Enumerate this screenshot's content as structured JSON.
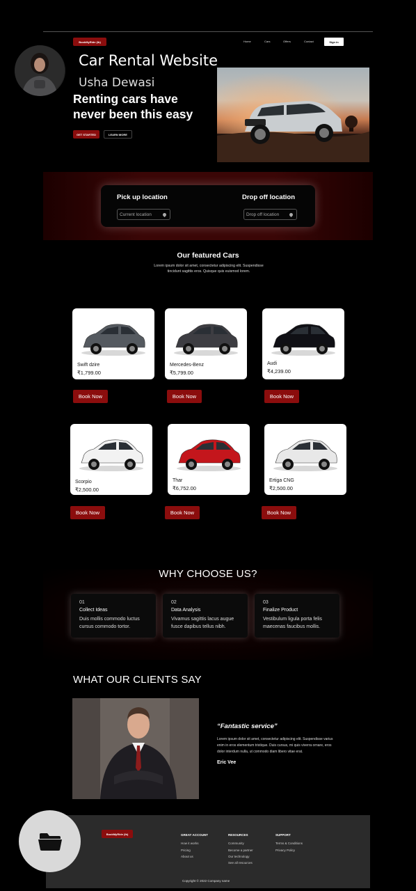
{
  "brand": "BookMyRide (ib)",
  "nav": {
    "links": [
      "Home",
      "Cars",
      "Offers",
      "Contact"
    ],
    "signin": "Sign in"
  },
  "overlay": {
    "title": "Car Rental Website",
    "name": "Usha Dewasi"
  },
  "hero": {
    "title": "Renting cars have never been this easy",
    "get_started": "GET STARTED",
    "learn_more": "LEARN MORE"
  },
  "location": {
    "pickup_label": "Pick up location",
    "pickup_placeholder": "Current location",
    "dropoff_label": "Drop off location",
    "dropoff_placeholder": "Drop off location"
  },
  "featured": {
    "title": "Our featured Cars",
    "description": "Lorem ipsum dolor sit amet, consectetur adipiscing elit. Suspendisse tincidunt sagittis eros. Quisque quis euismod lorem."
  },
  "cars": [
    {
      "name": "Swift dzire",
      "price": "₹1,799.00",
      "color": "#555a60"
    },
    {
      "name": "Mercedes-Benz",
      "price": "₹5,799.00",
      "color": "#3d3d42"
    },
    {
      "name": "Audi",
      "price": "₹4,239.00",
      "color": "#101015"
    },
    {
      "name": "Scorpio",
      "price": "₹2,500.00",
      "color": "#f2f2f2"
    },
    {
      "name": "Thar",
      "price": "₹6,752.00",
      "color": "#c4161c"
    },
    {
      "name": "Ertiga CNG",
      "price": "₹2,500.00",
      "color": "#e8e8e8"
    }
  ],
  "book_now": "Book Now",
  "why": {
    "title": "WHY CHOOSE US?",
    "items": [
      {
        "num": "01",
        "head": "Collect Ideas",
        "text": "Duis mollis commodo luctus cursus commodo tortor."
      },
      {
        "num": "02",
        "head": "Data Analysis",
        "text": "Vivamus sagittis lacus augue fusce dapibus tellus nibh."
      },
      {
        "num": "03",
        "head": "Finalize Product",
        "text": "Vestibulum ligula porta felis maecenas faucibus mollis."
      }
    ]
  },
  "clients": {
    "title": "WHAT OUR CLIENTS SAY",
    "quote": "“Fantastic service”",
    "text": "Lorem ipsum dolor sit amet, consectetur adipiscing elit. Suspendisse varius enim in eros elementum tristique. Duis cursus, mi quis viverra ornare, eros dolor interdum nulla, ut commodo diam libero vitae erat.",
    "author": "Eric Vee"
  },
  "footer": {
    "columns": [
      {
        "title": "GREAT ACCOUNT",
        "links": [
          "How it works",
          "Pricing",
          "About us"
        ]
      },
      {
        "title": "RESOURCES",
        "links": [
          "Community",
          "Become a partner",
          "Our technology",
          "See all resources"
        ]
      },
      {
        "title": "SUPPORT",
        "links": [
          "Terms & Conditions",
          "Privacy Policy"
        ]
      }
    ],
    "copyright": "Copyright © 2022 Company name"
  }
}
